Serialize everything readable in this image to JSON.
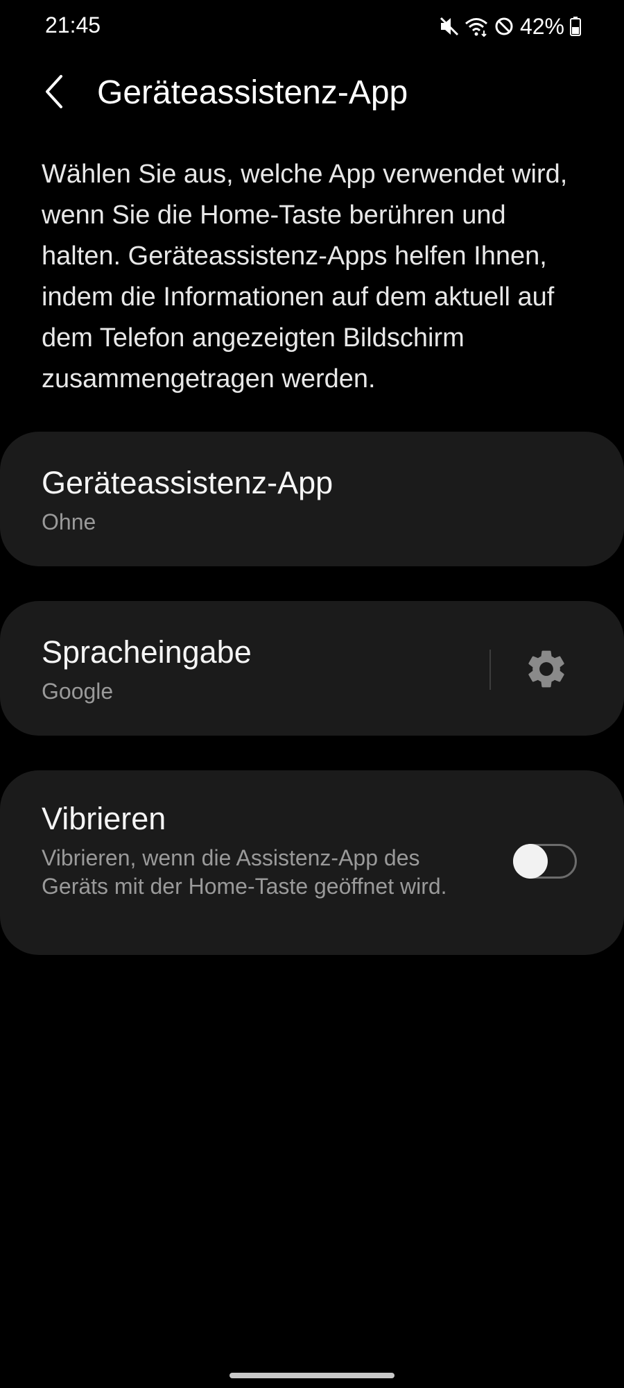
{
  "status_bar": {
    "time": "21:45",
    "battery_percent": "42%",
    "icons": [
      "mute-icon",
      "wifi-icon",
      "do-not-disturb-icon",
      "battery-icon"
    ]
  },
  "header": {
    "back_icon": "back-chevron-icon",
    "title": "Geräteassistenz-App"
  },
  "description": "Wählen Sie aus, welche App verwendet wird, wenn Sie die Home-Taste berühren und halten. Geräteassistenz-Apps helfen Ihnen, indem die Informationen auf dem aktuell auf dem Telefon angezeigten Bildschirm zusammengetragen werden.",
  "settings": {
    "assistant_app": {
      "title": "Geräteassistenz-App",
      "value": "Ohne"
    },
    "voice_input": {
      "title": "Spracheingabe",
      "value": "Google",
      "action_icon": "gear-icon"
    },
    "vibrate": {
      "title": "Vibrieren",
      "description": "Vibrieren, wenn die Assistenz-App des Geräts mit der Home-Taste geöffnet wird.",
      "enabled": false
    }
  },
  "colors": {
    "background": "#000000",
    "card": "#1b1b1b",
    "primary_text": "#f5f5f5",
    "secondary_text": "#9a9a9a",
    "icon": "#8a8a8a"
  }
}
